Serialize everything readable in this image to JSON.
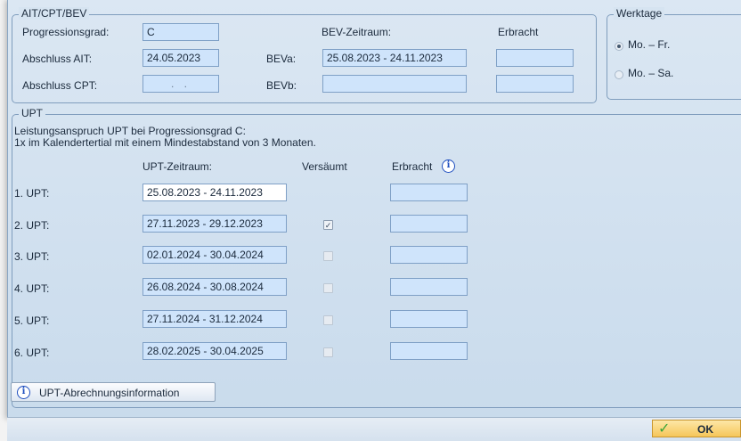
{
  "ait_group": {
    "legend": "AIT/CPT/BEV",
    "progressionsgrad_label": "Progressionsgrad:",
    "progressionsgrad_value": "C",
    "abschluss_ait_label": "Abschluss AIT:",
    "abschluss_ait_value": "24.05.2023",
    "abschluss_cpt_label": "Abschluss CPT:",
    "abschluss_cpt_value": ". .",
    "bev_zeitraum_header": "BEV-Zeitraum:",
    "erbracht_header": "Erbracht",
    "beva_label": "BEVa:",
    "beva_value": "25.08.2023 - 24.11.2023",
    "bevb_label": "BEVb:",
    "bevb_value": ""
  },
  "werktage": {
    "legend": "Werktage",
    "options": [
      {
        "label": "Mo. – Fr.",
        "selected": true
      },
      {
        "label": "Mo. – Sa.",
        "selected": false
      }
    ]
  },
  "upt": {
    "legend": "UPT",
    "info_line1": "Leistungsanspruch UPT bei Progressionsgrad C:",
    "info_line2": "1x im Kalendertertial mit einem Mindestabstand von 3 Monaten.",
    "col_zeitraum": "UPT-Zeitraum:",
    "col_versaeumt": "Versäumt",
    "col_erbracht": "Erbracht",
    "rows": [
      {
        "label": "1. UPT:",
        "zeitraum": "25.08.2023 - 24.11.2023",
        "versaeumt": null
      },
      {
        "label": "2. UPT:",
        "zeitraum": "27.11.2023 - 29.12.2023",
        "versaeumt": true
      },
      {
        "label": "3. UPT:",
        "zeitraum": "02.01.2024 - 30.04.2024",
        "versaeumt": false
      },
      {
        "label": "4. UPT:",
        "zeitraum": "26.08.2024 - 30.08.2024",
        "versaeumt": false
      },
      {
        "label": "5. UPT:",
        "zeitraum": "27.11.2024 - 31.12.2024",
        "versaeumt": false
      },
      {
        "label": "6. UPT:",
        "zeitraum": "28.02.2025 - 30.04.2025",
        "versaeumt": false
      }
    ],
    "abrechnung_button": "UPT-Abrechnungsinformation"
  },
  "footer": {
    "ok_label": "OK"
  },
  "icons": {
    "info": "info-icon",
    "ok_check": "checkmark-icon"
  },
  "colors": {
    "field_bg": "#cfe4fb",
    "window_bg": "#d3e2f0",
    "info_blue": "#1f4fbf",
    "ok_bg": "#f6c65a",
    "check_green": "#3aa53a"
  }
}
